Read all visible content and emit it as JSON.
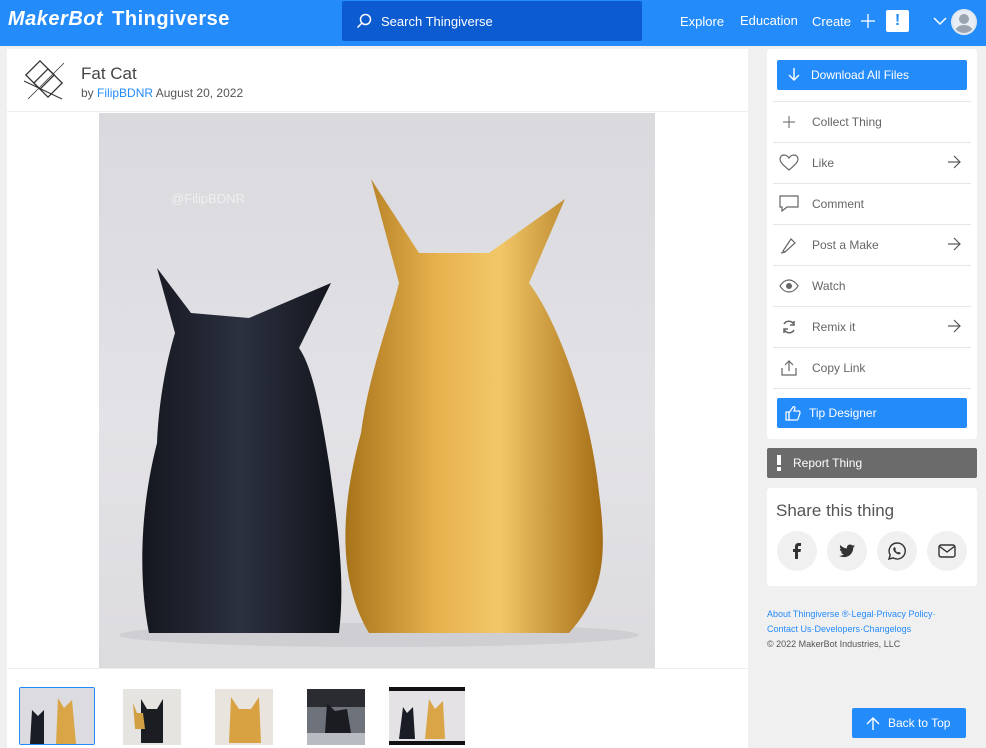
{
  "header": {
    "logo_left": "MakerBot",
    "logo_right": "Thingiverse",
    "search_placeholder": "Search Thingiverse",
    "nav": [
      "Explore",
      "Education",
      "Create"
    ],
    "alert": "!"
  },
  "thing": {
    "title": "Fat Cat",
    "by": "by",
    "author": "FilipBDNR",
    "date": "August 20, 2022",
    "watermark": "@FilipBDNR"
  },
  "actions": {
    "download": "Download All Files",
    "items": [
      "Collect Thing",
      "Like",
      "Comment",
      "Post a Make",
      "Watch",
      "Remix it",
      "Copy Link"
    ],
    "tip": "Tip Designer",
    "report": "Report Thing"
  },
  "share": {
    "title": "Share this thing",
    "icons": [
      "facebook-icon",
      "twitter-icon",
      "whatsapp-icon",
      "email-icon"
    ]
  },
  "footer": {
    "line1": [
      "About Thingiverse ®",
      "Legal",
      "Privacy Policy"
    ],
    "line2": [
      "Contact Us",
      "Developers",
      "Changelogs"
    ],
    "copyright": "©  2022  MakerBot Industries, LLC"
  },
  "back_to_top": "Back to Top",
  "colors": {
    "accent": "#248bfb",
    "search_bg": "#0d5bd1",
    "report_bg": "#6b6b6b"
  }
}
